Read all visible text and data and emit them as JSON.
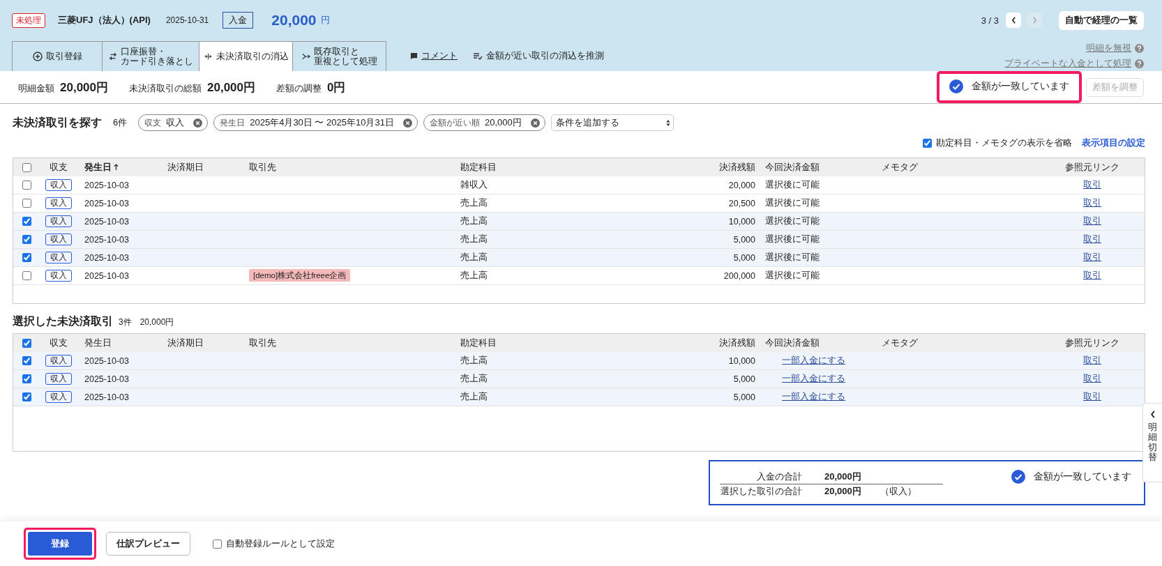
{
  "header": {
    "status_badge": "未処理",
    "bank": "三菱UFJ（法人）(API)",
    "date": "2025-10-31",
    "type_badge": "入金",
    "amount": "20,000",
    "currency": "円",
    "pager": "3 / 3",
    "pager_buttons": [
      {
        "kind": "prev",
        "disabled": false
      },
      {
        "kind": "next",
        "disabled": true
      }
    ],
    "list_button": "自動で経理の一覧",
    "side_links": [
      "明細を無視",
      "プライベートな入金として処理"
    ]
  },
  "tabs": [
    {
      "lines": [
        "取引登録"
      ],
      "selected": false
    },
    {
      "lines": [
        "口座振替・",
        "カード引き落とし"
      ],
      "selected": false
    },
    {
      "lines": [
        "未決済取引の消込"
      ],
      "selected": true
    },
    {
      "lines": [
        "既存取引と",
        "重複として処理"
      ],
      "selected": false
    }
  ],
  "actions": [
    {
      "kind": "link",
      "label": "コメント"
    },
    {
      "kind": "action",
      "label": "金額が近い取引の消込を推測"
    }
  ],
  "summary": {
    "items": [
      {
        "label": "明細金額",
        "value": "20,000円"
      },
      {
        "label": "未決済取引の総額",
        "value": "20,000円"
      },
      {
        "label": "差額の調整",
        "value": "0円"
      }
    ],
    "match_status": {
      "text": "金額が一致しています",
      "highlighted": true
    },
    "adjust_button": {
      "label": "差額を調整",
      "disabled": true
    }
  },
  "search": {
    "title": "未決済取引を探す",
    "count": "6件",
    "filters": [
      {
        "label": "収支",
        "value": "収入"
      },
      {
        "label": "発生日",
        "value": "2025年4月30日 〜 2025年10月31日"
      },
      {
        "label": "金額が近い順",
        "value": "20,000円"
      }
    ],
    "add_condition": "条件を追加する",
    "omit_option": {
      "label": "勘定科目・メモタグの表示を省略",
      "checked": true
    },
    "settings_link": "表示項目の設定"
  },
  "candidates": {
    "all_checked": false,
    "columns": [
      {
        "label": "収支",
        "sorted": false
      },
      {
        "label": "発生日",
        "sorted": true
      },
      {
        "label": "決済期日",
        "sorted": false
      },
      {
        "label": "取引先",
        "sorted": false
      },
      {
        "label": "勘定科目",
        "sorted": false
      },
      {
        "label": "決済残額",
        "sorted": false
      },
      {
        "label": "今回決済金額",
        "sorted": false
      },
      {
        "label": "メモタグ",
        "sorted": false
      },
      {
        "label": "参照元リンク",
        "sorted": false
      }
    ],
    "rows": [
      {
        "checked": false,
        "type": "収入",
        "date": "2025-10-03",
        "account": "雑収入",
        "balance": "20,000",
        "amount": {
          "kind": "text",
          "text": "選択後に可能"
        },
        "link": "取引"
      },
      {
        "checked": false,
        "type": "収入",
        "date": "2025-10-03",
        "account": "売上高",
        "balance": "20,500",
        "amount": {
          "kind": "text",
          "text": "選択後に可能"
        },
        "link": "取引"
      },
      {
        "checked": true,
        "type": "収入",
        "date": "2025-10-03",
        "account": "売上高",
        "balance": "10,000",
        "amount": {
          "kind": "text",
          "text": "選択後に可能"
        },
        "link": "取引"
      },
      {
        "checked": true,
        "type": "収入",
        "date": "2025-10-03",
        "account": "売上高",
        "balance": "5,000",
        "amount": {
          "kind": "text",
          "text": "選択後に可能"
        },
        "link": "取引"
      },
      {
        "checked": true,
        "type": "収入",
        "date": "2025-10-03",
        "account": "売上高",
        "balance": "5,000",
        "amount": {
          "kind": "text",
          "text": "選択後に可能"
        },
        "link": "取引"
      },
      {
        "checked": false,
        "type": "収入",
        "date": "2025-10-03",
        "partner": "[demo]株式会社freee企画",
        "account": "売上高",
        "balance": "200,000",
        "amount": {
          "kind": "text",
          "text": "選択後に可能"
        },
        "link": "取引"
      }
    ]
  },
  "selected": {
    "title": "選択した未決済取引",
    "count": "3件",
    "total": "20,000円",
    "all_checked": true,
    "columns": [
      {
        "label": "収支",
        "sorted": false
      },
      {
        "label": "発生日",
        "sorted": false
      },
      {
        "label": "決済期日",
        "sorted": false
      },
      {
        "label": "取引先",
        "sorted": false
      },
      {
        "label": "勘定科目",
        "sorted": false
      },
      {
        "label": "決済残額",
        "sorted": false
      },
      {
        "label": "今回決済金額",
        "sorted": false
      },
      {
        "label": "メモタグ",
        "sorted": false
      },
      {
        "label": "参照元リンク",
        "sorted": false
      }
    ],
    "rows": [
      {
        "checked": true,
        "type": "収入",
        "date": "2025-10-03",
        "account": "売上高",
        "balance": "10,000",
        "amount": {
          "kind": "link",
          "text": "一部入金にする"
        },
        "link": "取引"
      },
      {
        "checked": true,
        "type": "収入",
        "date": "2025-10-03",
        "account": "売上高",
        "balance": "5,000",
        "amount": {
          "kind": "link",
          "text": "一部入金にする"
        },
        "link": "取引"
      },
      {
        "checked": true,
        "type": "収入",
        "date": "2025-10-03",
        "account": "売上高",
        "balance": "5,000",
        "amount": {
          "kind": "link",
          "text": "一部入金にする"
        },
        "link": "取引"
      }
    ]
  },
  "totals_box": {
    "rows": [
      {
        "label": "入金の合計",
        "value": "20,000円"
      },
      {
        "label": "選択した取引の合計",
        "value": "20,000円",
        "note": "（収入）"
      }
    ],
    "match_status": {
      "text": "金額が一致しています"
    }
  },
  "footer": {
    "register_button": {
      "label": "登録",
      "highlighted": true
    },
    "preview_button": "仕訳プレビュー",
    "auto_rule": {
      "label": "自動登録ルールとして設定",
      "checked": false
    }
  },
  "side_tab": {
    "label": "明細切替"
  }
}
